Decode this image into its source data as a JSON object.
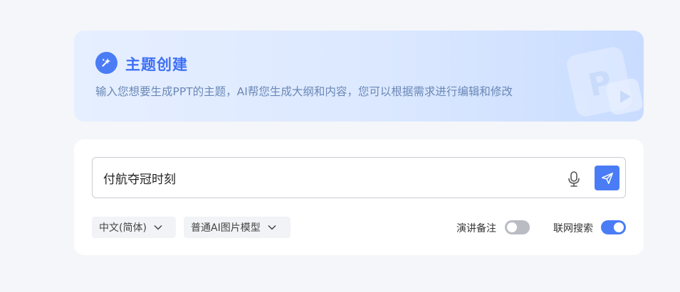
{
  "banner": {
    "title": "主题创建",
    "subtitle": "输入您想要生成PPT的主题，AI帮您生成大纲和内容，您可以根据需求进行编辑和修改",
    "icon": "sparkle-icon",
    "decoration_icon": "ppt-play-icon"
  },
  "prompt": {
    "value": "付航夺冠时刻",
    "mic_icon": "microphone-icon",
    "send_icon": "send-icon"
  },
  "options": {
    "language": "中文(简体)",
    "image_model": "普通AI图片模型"
  },
  "toggles": {
    "speaker_notes": {
      "label": "演讲备注",
      "state": "off"
    },
    "web_search": {
      "label": "联网搜索",
      "state": "on"
    }
  },
  "colors": {
    "accent": "#4a7cf6",
    "background": "#f4f6f9"
  }
}
